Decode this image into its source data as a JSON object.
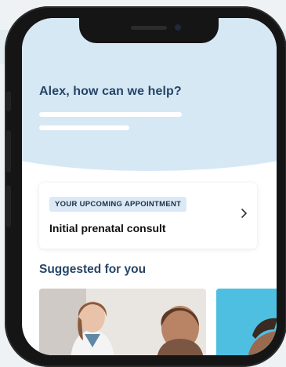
{
  "home": {
    "greeting": "Alex, how can we help?"
  },
  "appointment": {
    "badge": "YOUR UPCOMING APPOINTMENT",
    "title": "Initial prenatal consult",
    "chevron_icon": "chevron-right-icon"
  },
  "suggested": {
    "title": "Suggested for you"
  },
  "colors": {
    "hero_bg": "#d7e8f5",
    "heading": "#264566",
    "badge_bg": "#dbe9f6",
    "card2_bg": "#4fbfe1"
  }
}
